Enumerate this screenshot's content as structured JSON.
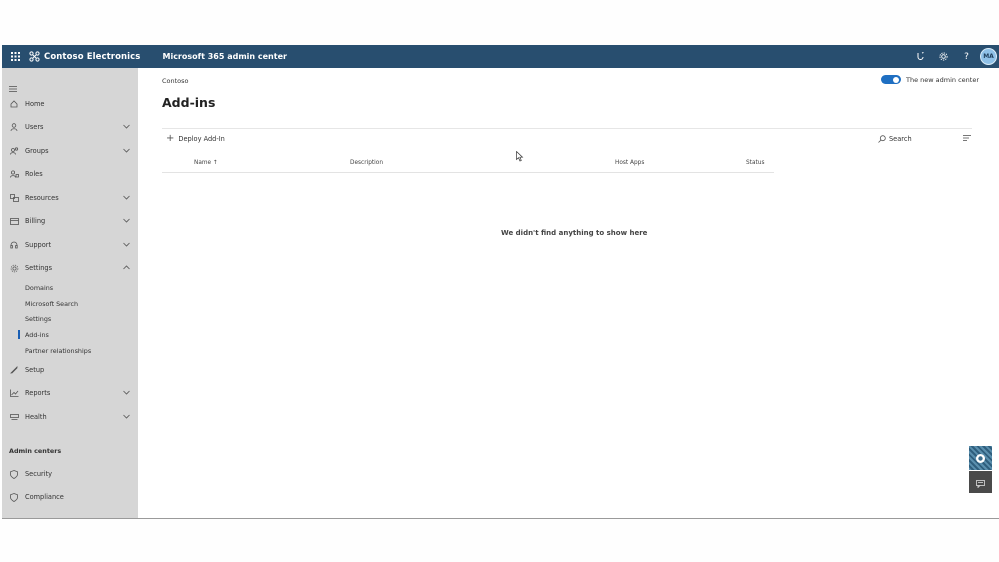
{
  "topbar": {
    "org_name": "Contoso Electronics",
    "app_name": "Microsoft 365 admin center",
    "avatar_initials": "MA",
    "bar_color": "#284e6f"
  },
  "sidebar": {
    "items": [
      {
        "label": "Home",
        "icon": "home-icon"
      },
      {
        "label": "Users",
        "icon": "person-icon"
      },
      {
        "label": "Groups",
        "icon": "group-icon"
      },
      {
        "label": "Roles",
        "icon": "roles-icon"
      },
      {
        "label": "Resources",
        "icon": "resources-icon"
      },
      {
        "label": "Billing",
        "icon": "billing-icon"
      },
      {
        "label": "Support",
        "icon": "support-icon"
      },
      {
        "label": "Settings",
        "icon": "gear-icon"
      }
    ],
    "settings_sub": [
      "Domains",
      "Microsoft Search",
      "Settings",
      "Add-ins",
      "Partner relationships"
    ],
    "items_after": [
      {
        "label": "Setup",
        "icon": "setup-icon"
      },
      {
        "label": "Reports",
        "icon": "reports-icon"
      },
      {
        "label": "Health",
        "icon": "health-icon"
      }
    ],
    "admin_centers_label": "Admin centers",
    "admin_centers": [
      {
        "label": "Security",
        "icon": "shield-icon"
      },
      {
        "label": "Compliance",
        "icon": "compliance-icon"
      }
    ]
  },
  "main": {
    "breadcrumb": "Contoso",
    "title": "Add-ins",
    "toggle_label": "The new admin center",
    "deploy_label": "Deploy Add-In",
    "search_label": "Search",
    "columns": [
      "Name ↑",
      "Description",
      "Host Apps",
      "Status"
    ],
    "empty_message": "We didn't find anything to show here"
  }
}
